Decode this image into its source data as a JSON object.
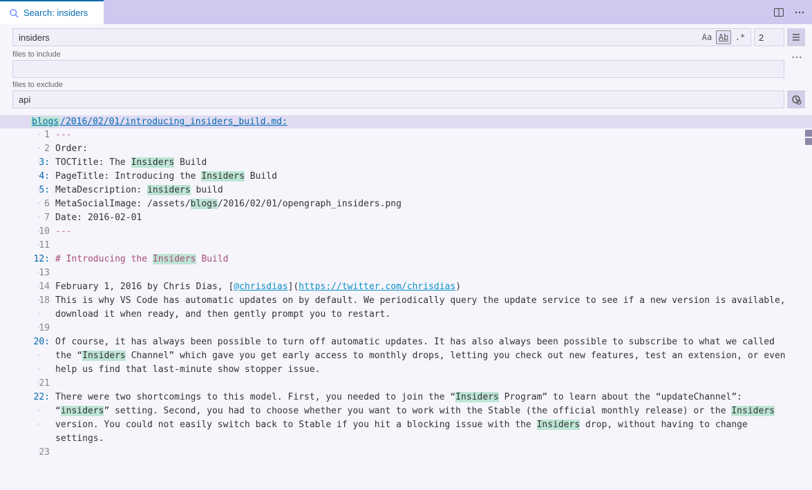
{
  "tab": {
    "label": "Search: insiders"
  },
  "search": {
    "query": "insiders",
    "include_label": "files to include",
    "include_value": "",
    "exclude_label": "files to exclude",
    "exclude_value": "api",
    "result_count": "2"
  },
  "file": {
    "folder": "blogs",
    "rest_path": "/2016/02/01/introducing_insiders_build.md:"
  },
  "lines": [
    {
      "num": "1",
      "match": false,
      "segs": [
        {
          "t": "---",
          "c": "frontdash"
        }
      ]
    },
    {
      "num": "2",
      "match": false,
      "segs": [
        {
          "t": "Order:"
        }
      ]
    },
    {
      "num": "3",
      "match": true,
      "segs": [
        {
          "t": "TOCTitle: The "
        },
        {
          "t": "Insiders",
          "c": "hl"
        },
        {
          "t": " Build"
        }
      ]
    },
    {
      "num": "4",
      "match": true,
      "segs": [
        {
          "t": "PageTitle: Introducing the "
        },
        {
          "t": "Insiders",
          "c": "hl"
        },
        {
          "t": " Build"
        }
      ]
    },
    {
      "num": "5",
      "match": true,
      "segs": [
        {
          "t": "MetaDescription: "
        },
        {
          "t": "insiders",
          "c": "hl"
        },
        {
          "t": " build"
        }
      ]
    },
    {
      "num": "6",
      "match": false,
      "segs": [
        {
          "t": "MetaSocialImage: /assets/"
        },
        {
          "t": "blogs",
          "c": "hl"
        },
        {
          "t": "/2016/02/01/opengraph_insiders.png"
        }
      ]
    },
    {
      "num": "7",
      "match": false,
      "segs": [
        {
          "t": "Date: 2016-02-01"
        }
      ]
    },
    {
      "num": "",
      "match": false,
      "segs": []
    },
    {
      "num": "10",
      "match": false,
      "segs": [
        {
          "t": "---",
          "c": "frontdash"
        }
      ]
    },
    {
      "num": "11",
      "match": false,
      "segs": []
    },
    {
      "num": "12",
      "match": true,
      "segs": [
        {
          "t": "# Introducing the ",
          "c": "heading"
        },
        {
          "t": "Insiders",
          "c": "heading hl"
        },
        {
          "t": " Build",
          "c": "heading"
        }
      ]
    },
    {
      "num": "13",
      "match": false,
      "segs": []
    },
    {
      "num": "14",
      "match": false,
      "segs": [
        {
          "t": "February 1, 2016 by Chris Dias, ["
        },
        {
          "t": "@chrisdias",
          "c": "mention"
        },
        {
          "t": "]("
        },
        {
          "t": "https://twitter.com/chrisdias",
          "c": "urllink"
        },
        {
          "t": ")"
        }
      ]
    },
    {
      "num": "",
      "match": false,
      "segs": []
    },
    {
      "num": "18",
      "match": false,
      "segs": [
        {
          "t": "This is why VS Code has automatic updates on by default. We periodically query the update service to see if a new version is available, "
        }
      ]
    },
    {
      "wrap": true,
      "segs": [
        {
          "t": "download it when ready, and then gently prompt you to restart."
        }
      ]
    },
    {
      "num": "19",
      "match": false,
      "segs": []
    },
    {
      "num": "20",
      "match": true,
      "segs": [
        {
          "t": "Of course, it has always been possible to turn off automatic updates. It has also always been possible to subscribe to what we called "
        }
      ]
    },
    {
      "wrap": true,
      "segs": [
        {
          "t": "the “"
        },
        {
          "t": "Insiders",
          "c": "hl"
        },
        {
          "t": " Channel” which gave you get early access to monthly drops, letting you check out new features, test an extension, or even "
        }
      ]
    },
    {
      "wrap": true,
      "segs": [
        {
          "t": "help us find that last-minute show stopper issue."
        }
      ]
    },
    {
      "num": "21",
      "match": false,
      "segs": []
    },
    {
      "num": "22",
      "match": true,
      "segs": [
        {
          "t": "There were two shortcomings to this model. First, you needed to join the “"
        },
        {
          "t": "Insiders",
          "c": "hl"
        },
        {
          "t": " Program” to learn about the “updateChannel”: "
        }
      ]
    },
    {
      "wrap": true,
      "segs": [
        {
          "t": "“"
        },
        {
          "t": "insiders",
          "c": "hl"
        },
        {
          "t": "” setting. Second, you had to choose whether you want to work with the Stable (the official monthly release) or the "
        },
        {
          "t": "Insiders",
          "c": "hl"
        },
        {
          "t": " "
        }
      ]
    },
    {
      "wrap": true,
      "segs": [
        {
          "t": "version. You could not easily switch back to Stable if you hit a blocking issue with the "
        },
        {
          "t": "Insiders",
          "c": "hl"
        },
        {
          "t": " drop, without having to change settings."
        }
      ]
    },
    {
      "num": "23",
      "match": false,
      "segs": []
    }
  ]
}
